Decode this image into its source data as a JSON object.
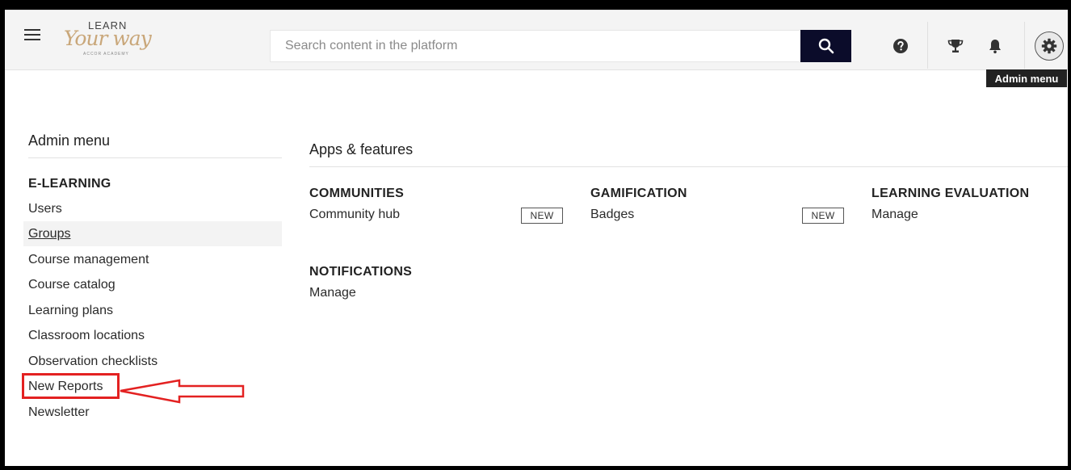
{
  "header": {
    "logo": {
      "learn": "LEARN",
      "your": "Your way",
      "academy": "ACCOR ACADEMY"
    },
    "search": {
      "placeholder": "Search content in the platform"
    },
    "tooltip": "Admin menu"
  },
  "icons": {
    "menu": "hamburger-icon",
    "search": "search-icon",
    "help": "help-icon",
    "trophy": "trophy-icon",
    "bell": "bell-icon",
    "gear": "gear-icon"
  },
  "sidebar": {
    "title": "Admin menu",
    "section": "E-LEARNING",
    "items": [
      {
        "label": "Users"
      },
      {
        "label": "Groups"
      },
      {
        "label": "Course management"
      },
      {
        "label": "Course catalog"
      },
      {
        "label": "Learning plans"
      },
      {
        "label": "Classroom locations"
      },
      {
        "label": "Observation checklists"
      },
      {
        "label": "New Reports"
      },
      {
        "label": "Newsletter"
      }
    ]
  },
  "main": {
    "title": "Apps & features",
    "categories": [
      {
        "title": "COMMUNITIES",
        "link": "Community hub",
        "badge": "NEW"
      },
      {
        "title": "GAMIFICATION",
        "link": "Badges",
        "badge": "NEW"
      },
      {
        "title": "LEARNING EVALUATION",
        "link": "Manage"
      },
      {
        "title": "NOTIFICATIONS",
        "link": "Manage"
      }
    ]
  },
  "colors": {
    "search_button": "#0b0c2a",
    "highlight": "#e32121",
    "logo_gold": "#c9a77a"
  }
}
